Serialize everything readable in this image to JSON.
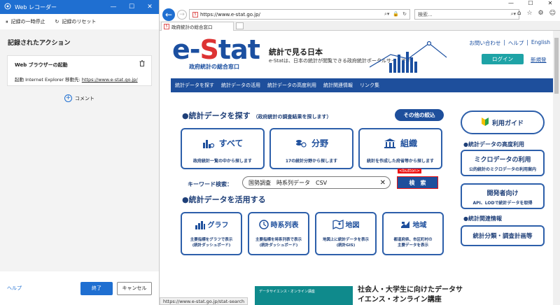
{
  "recorder": {
    "title": "Web レコーダー",
    "pause": "記録の一時停止",
    "reset": "記録のリセット",
    "section": "記録されたアクション",
    "action_title": "Web ブラウザーの起動",
    "action_prefix": "起動 Internet Explorer 移動先: ",
    "action_url": "https://www.e-stat.go.jp/",
    "comment": "コメント",
    "help": "ヘルプ",
    "done": "終了",
    "cancel": "キャンセル"
  },
  "browser": {
    "url": "https://www.e-stat.go.jp/",
    "search_placeholder": "検索...",
    "tab_title": "政府統計の総合窓口",
    "status_url": "https://www.e-stat.go.jp/stat-search"
  },
  "site": {
    "logo_e": "e-",
    "logo_s": "S",
    "logo_rest": "tat",
    "logo_sub": "政府統計の総合窓口",
    "tagline": "統計で見る日本",
    "description": "e-Statは、日本の統計が閲覧できる政府統計ポータルサイトです",
    "contact": "お問い合わせ",
    "help": "ヘルプ",
    "english": "English",
    "login": "ログイン",
    "register": "新規登",
    "nav": [
      "統計データを探す",
      "統計データの活用",
      "統計データの高度利用",
      "統計関連情報",
      "リンク集"
    ],
    "find": {
      "heading": "●統計データを探す",
      "note": "（政府統計の調査結果を探します）",
      "other": "その他の絞込",
      "boxes": [
        {
          "title": "すべて",
          "desc": "政府統計一覧の中から探します",
          "icon": "bars-search-icon"
        },
        {
          "title": "分野",
          "desc": "17の統計分野から探します",
          "icon": "coins-search-icon"
        },
        {
          "title": "組織",
          "desc": "統計を作成した府省等から探します",
          "icon": "building-icon"
        }
      ],
      "keyword_label": "キーワード検索：",
      "keyword_value": "国勢調査　時系列データ　CSV",
      "search_button": "検　索",
      "button_tag": "<button>"
    },
    "use": {
      "heading": "●統計データを活用する",
      "boxes": [
        {
          "title": "グラフ",
          "desc": "主要指標をグラフで表示\n(統計ダッシュボード)",
          "icon": "chart-icon"
        },
        {
          "title": "時系列表",
          "desc": "主要指標を時系列表で表示\n(統計ダッシュボード)",
          "icon": "clock-icon"
        },
        {
          "title": "地図",
          "desc": "地図上に統計データを表示\n(統計GIS)",
          "icon": "map-icon"
        },
        {
          "title": "地域",
          "desc": "都道府県、市区町村の\n主要データを表示",
          "icon": "region-icon"
        }
      ]
    },
    "right": {
      "guide": "利用ガイド",
      "advanced_head": "●統計データの高度利用",
      "micro_title": "ミクロデータの利用",
      "micro_desc": "公的統計のミクロデータの利用案内",
      "dev_title": "開発者向け",
      "dev_desc": "API、LODで統計データを取得",
      "related_head": "●統計関連情報",
      "related_title": "統計分類・調査計画等"
    },
    "banner_text": "データサイエンス・オンライン講座",
    "promo_line1": "社会人・大学生に向けたデータサ",
    "promo_line2": "イエンス・オンライン講座"
  }
}
